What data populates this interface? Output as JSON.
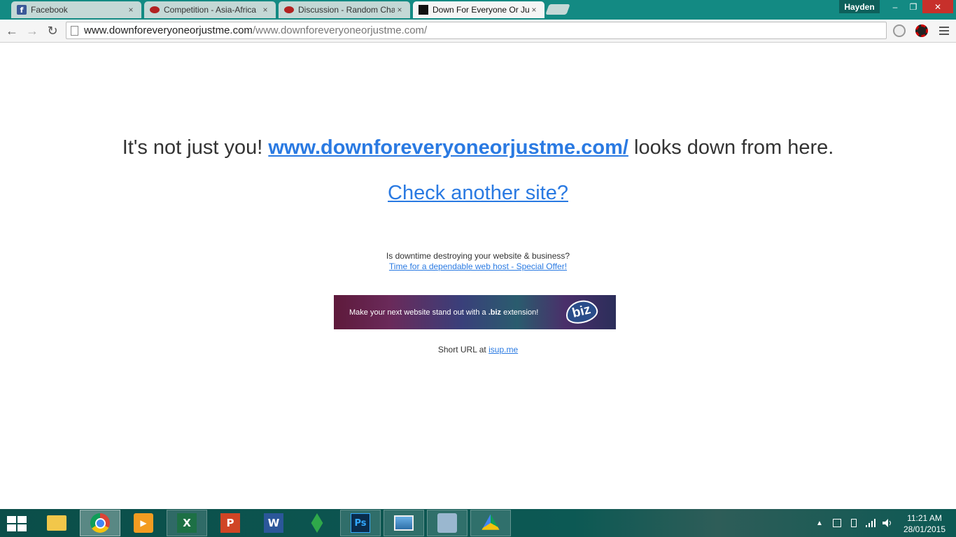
{
  "browser": {
    "tabs": [
      {
        "title": "Facebook",
        "icon": "facebook-icon",
        "active": false
      },
      {
        "title": "Competition - Asia-Africa",
        "icon": "football-icon",
        "active": false
      },
      {
        "title": "Discussion - Random Chat",
        "icon": "football-icon",
        "active": false
      },
      {
        "title": "Down For Everyone Or Just Me",
        "icon": "downforeveryone-icon",
        "active": true
      }
    ],
    "tab_close_glyph": "×",
    "user_name": "Hayden",
    "window_controls": {
      "minimize": "–",
      "maximize": "❐",
      "close": "✕"
    },
    "nav": {
      "back": "←",
      "forward": "→",
      "reload": "↻"
    },
    "url": {
      "host": "www.downforeveryoneorjustme.com",
      "path": "/www.downforeveryoneorjustme.com/"
    }
  },
  "page": {
    "headline_prefix": "It's not just you! ",
    "headline_link": "www.downforeveryoneorjustme.com/",
    "headline_suffix": " looks down from here.",
    "check_another": "Check another site?",
    "promo_question": "Is downtime destroying your website & business?",
    "promo_link": "Time for a dependable web host - Special Offer!",
    "banner": {
      "text_before": "Make your next website stand out with a ",
      "text_bold": ".biz",
      "text_after": " extension!",
      "logo_text": "biz"
    },
    "short_url_label": "Short URL at ",
    "short_url_link": "isup.me"
  },
  "taskbar": {
    "apps": [
      {
        "name": "file-explorer",
        "glyph": ""
      },
      {
        "name": "chrome",
        "glyph": ""
      },
      {
        "name": "media-player",
        "glyph": "▶"
      },
      {
        "name": "excel",
        "glyph": "X"
      },
      {
        "name": "powerpoint",
        "glyph": "P"
      },
      {
        "name": "word",
        "glyph": "W"
      },
      {
        "name": "the-sims",
        "glyph": ""
      },
      {
        "name": "photoshop",
        "glyph": "Ps"
      },
      {
        "name": "photos",
        "glyph": ""
      },
      {
        "name": "setup",
        "glyph": ""
      },
      {
        "name": "google-drive",
        "glyph": ""
      }
    ],
    "tray_arrow": "▲",
    "clock_time": "11:21 AM",
    "clock_date": "28/01/2015"
  }
}
